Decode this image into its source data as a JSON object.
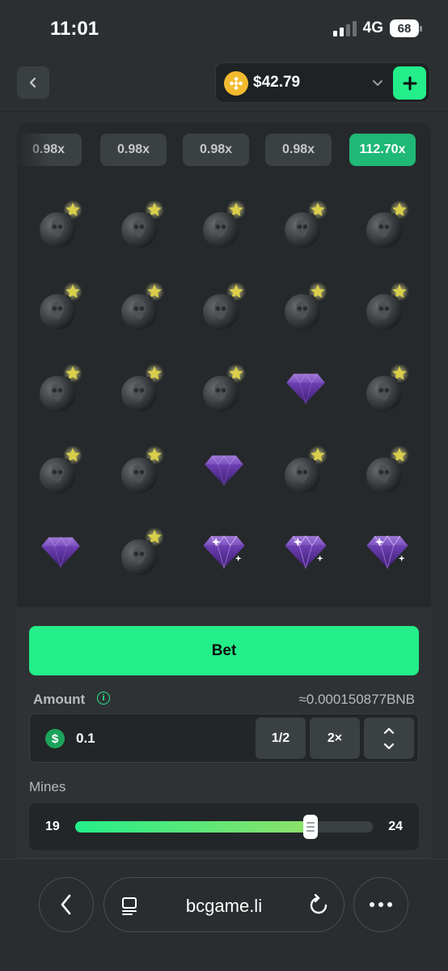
{
  "status_bar": {
    "time": "11:01",
    "network": "4G",
    "battery": "68"
  },
  "header": {
    "balance": "$42.79"
  },
  "multipliers": [
    "0.98x",
    "0.98x",
    "0.98x",
    "0.98x",
    "112.70x"
  ],
  "grid": {
    "rows": [
      [
        "bomb",
        "bomb",
        "bomb",
        "bomb",
        "bomb"
      ],
      [
        "bomb",
        "bomb",
        "bomb",
        "bomb",
        "bomb"
      ],
      [
        "bomb",
        "bomb",
        "bomb",
        "gem",
        "bomb"
      ],
      [
        "bomb",
        "bomb",
        "gem",
        "bomb",
        "bomb"
      ],
      [
        "gem",
        "bomb",
        "gem-found",
        "gem-found",
        "gem-found"
      ]
    ]
  },
  "controls": {
    "bet_label": "Bet",
    "amount_label": "Amount",
    "info_glyph": "i",
    "bnb_equivalent": "≈0.000150877BNB",
    "currency_glyph": "$",
    "amount_value": "0.1",
    "half_label": "1/2",
    "double_label": "2×",
    "mines_label": "Mines",
    "mines_min": "19",
    "mines_max": "24",
    "mines_level_fraction": 0.79
  },
  "browser": {
    "url": "bcgame.li"
  },
  "colors": {
    "accent": "#24ee89",
    "multiplier_active": "#1fb877",
    "bnb_coin": "#f3ba2f"
  }
}
